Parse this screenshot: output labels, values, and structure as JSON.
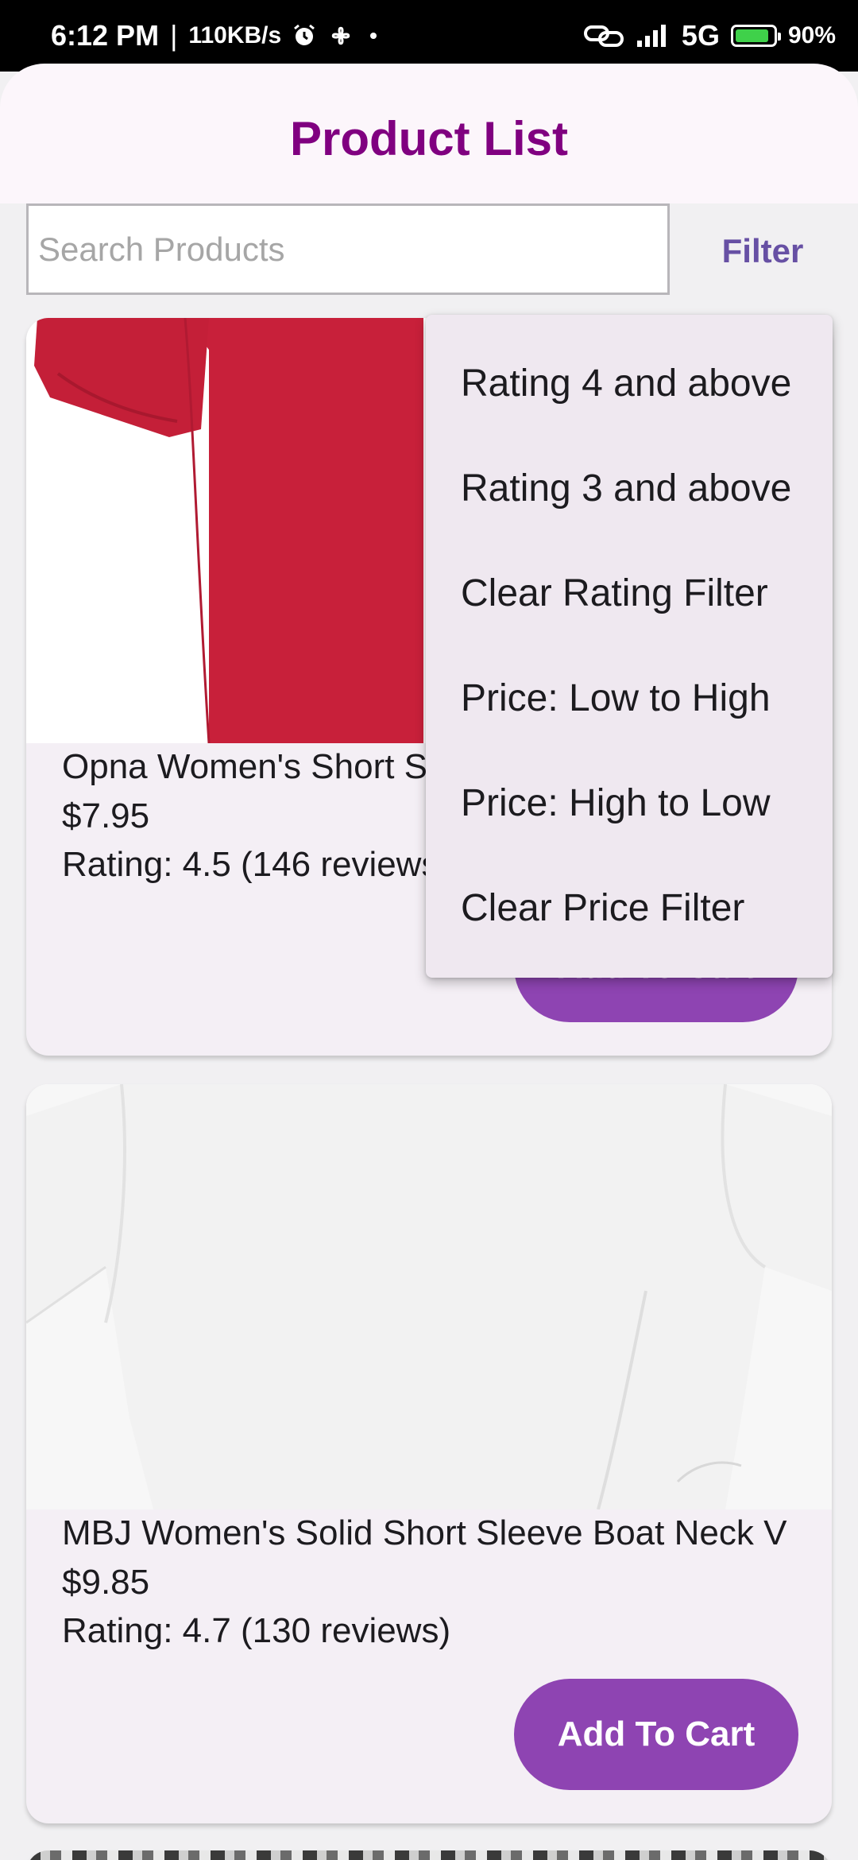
{
  "status_bar": {
    "time": "6:12 PM",
    "separator": "|",
    "speed": "110KB/s",
    "network": "5G",
    "battery": "90%",
    "battery_level": 0.9
  },
  "app_bar": {
    "title": "Product List"
  },
  "search": {
    "placeholder": "Search Products",
    "value": ""
  },
  "filter_label": "Filter",
  "filter_menu": {
    "items": [
      "Rating 4 and above",
      "Rating 3 and above",
      "Clear Rating Filter",
      "Price: Low to High",
      "Price: High to Low",
      "Clear Price Filter"
    ]
  },
  "products": [
    {
      "name": "Opna Women's Short Sl",
      "price": "$7.95",
      "rating": "Rating: 4.5 (146 reviews)",
      "button": "Add To Cart",
      "image_color": "#c8203a"
    },
    {
      "name": "MBJ Women's Solid Short Sleeve Boat Neck V",
      "price": "$9.85",
      "rating": "Rating: 4.7 (130 reviews)",
      "button": "Add To Cart",
      "image_color": "#ffffff"
    }
  ],
  "colors": {
    "title": "#800080",
    "filter": "#6750a4",
    "button": "#8e44b2",
    "card": "#f4eff5",
    "menu": "#efe8f0"
  }
}
